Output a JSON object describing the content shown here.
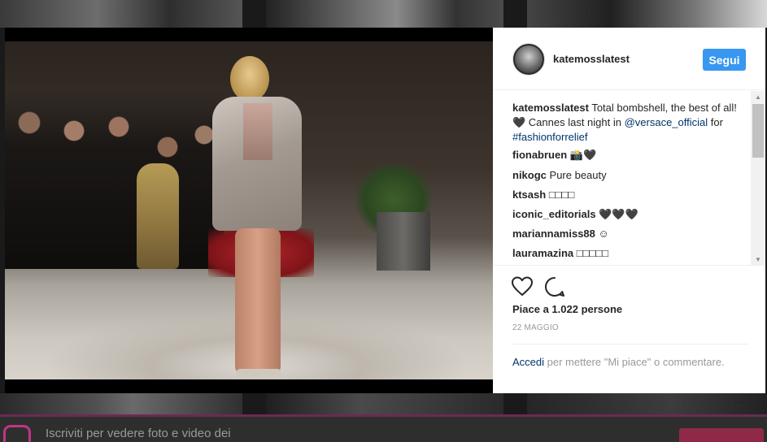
{
  "post": {
    "username": "katemosslatest",
    "follow_label": "Segui",
    "caption_user": "katemosslatest",
    "caption_text": " Total bombshell, the best of all! 🖤 Cannes last night in ",
    "caption_mention": "@versace_official",
    "caption_for": " for ",
    "caption_hashtag": "#fashionforrelief",
    "likes": "Piace a 1.022 persone",
    "date": "22 MAGGIO"
  },
  "comments": [
    {
      "user": "fionabruen",
      "text": " 📸🖤"
    },
    {
      "user": "nikogc",
      "text": " Pure beauty"
    },
    {
      "user": "ktsash",
      "text": " □□□□"
    },
    {
      "user": "iconic_editorials",
      "text": " 🖤🖤🖤"
    },
    {
      "user": "mariannamiss88",
      "text": " ☺"
    },
    {
      "user": "lauramazina",
      "text": " □□□□□"
    }
  ],
  "login_prompt": {
    "link": "Accedi",
    "text": " per mettere \"Mi piace\" o commentare."
  },
  "more_label": "•••",
  "bottom_bar": {
    "text": "Iscriviti per vedere foto e video dei"
  },
  "colors": {
    "follow_button": "#3897f0",
    "link": "#003569",
    "muted": "#999999"
  },
  "icons": [
    "heart-icon",
    "comment-icon",
    "scroll-up-icon",
    "scroll-down-icon",
    "instagram-logo-icon"
  ]
}
